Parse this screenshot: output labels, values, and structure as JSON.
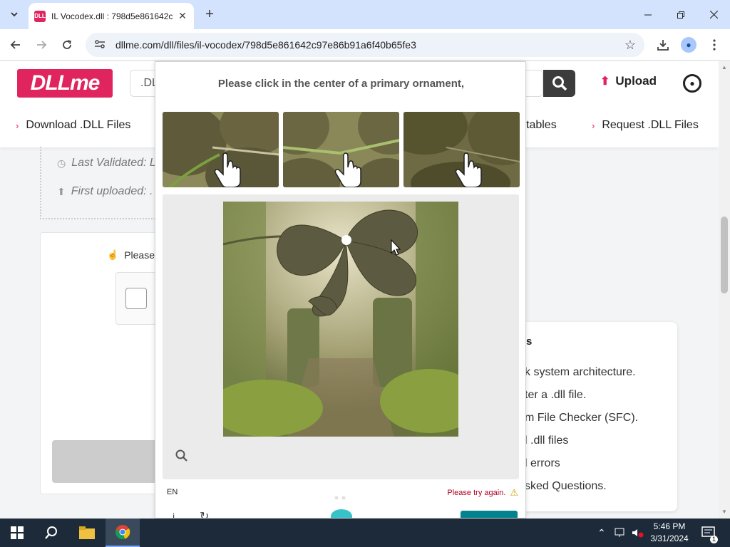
{
  "browser": {
    "tab_title": "IL Vocodex.dll : 798d5e861642c",
    "favicon_text": "DLL",
    "url": "dllme.com/dll/files/il-vocodex/798d5e861642c97e86b91a6f40b65fe3"
  },
  "site": {
    "logo": "DLLme",
    "search_placeholder": ".DL",
    "upload_label": "Upload",
    "nav": [
      "Download .DLL Files",
      "tables",
      "Request .DLL Files"
    ]
  },
  "file_meta": {
    "last_validated": "Last Validated: L",
    "first_uploaded": "First uploaded: ."
  },
  "verify": {
    "label": "Please"
  },
  "sidebar_card": {
    "title": "s",
    "items": [
      "k system architecture.",
      "ter a .dll file.",
      "m File Checker (SFC).",
      "l .dll files",
      "l errors",
      "sked Questions."
    ]
  },
  "captcha": {
    "prompt": "Please click in the center of a primary ornament,",
    "language": "EN",
    "error": "Please try again."
  },
  "taskbar": {
    "time": "5:46 PM",
    "date": "3/31/2024",
    "notification_count": "1"
  },
  "colors": {
    "brand": "#e0245e",
    "captcha_button": "#00838f"
  }
}
